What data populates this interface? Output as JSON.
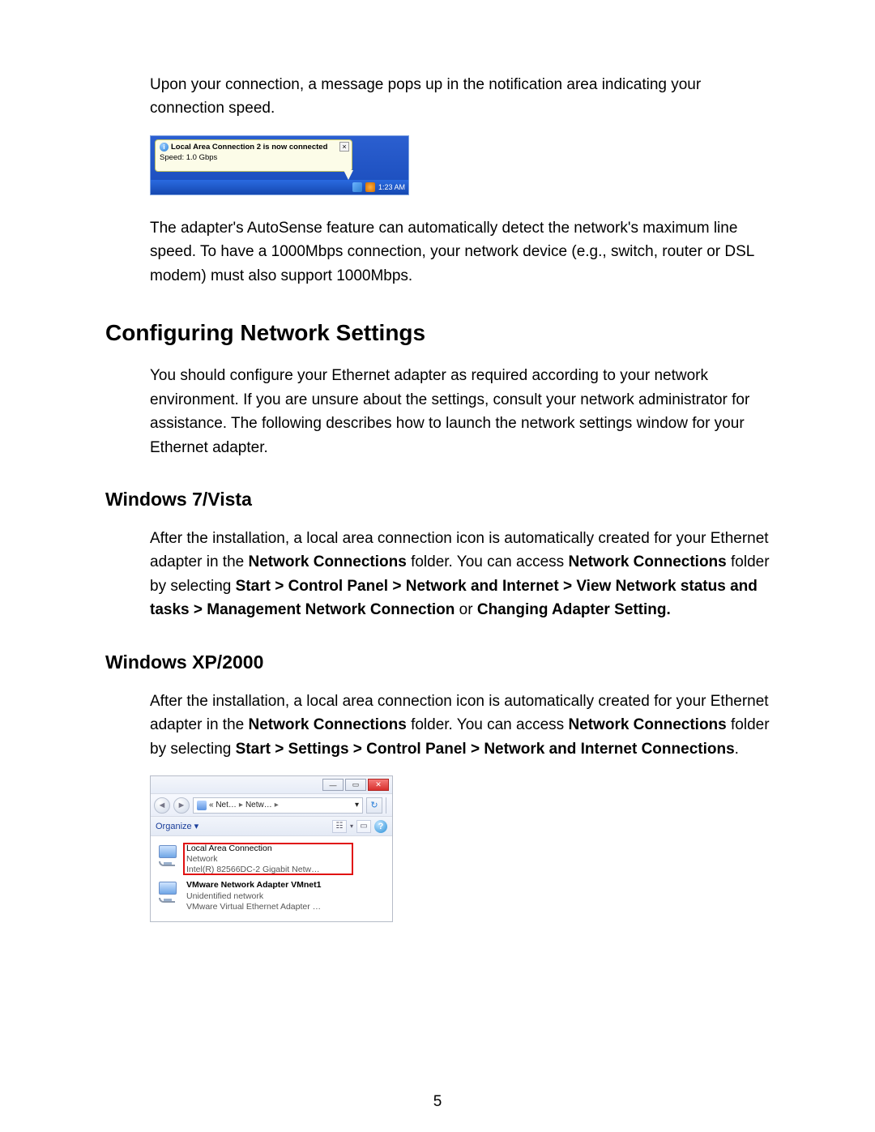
{
  "intro_para": "Upon your connection, a message pops up in the notification area indicating your connection speed.",
  "notification": {
    "title": "Local Area Connection 2 is now connected",
    "speed": "Speed: 1.0 Gbps",
    "clock": "1:23 AM",
    "close_glyph": "×",
    "info_glyph": "i"
  },
  "autosense_para": "The adapter's AutoSense feature can automatically detect the network's maximum line speed. To have a 1000Mbps connection, your network device (e.g., switch, router or DSL modem) must also support 1000Mbps.",
  "section_heading": "Configuring Network Settings",
  "configure_intro": "You should configure your Ethernet adapter as required according to your network environment. If you are unsure about the settings, consult your network administrator for assistance. The following describes how to launch the network settings window for your Ethernet adapter.",
  "sub1": {
    "heading": "Windows 7/Vista",
    "text_plain_prefix": "After the installation, a local area connection icon is automatically created for your Ethernet adapter in the ",
    "nc_bold": "Network Connections",
    "text_mid1": " folder. You can access ",
    "nc_bold2": "Network Connections",
    "text_mid2": " folder by selecting ",
    "path_bold": "Start > Control Panel > Network and Internet > View Network status and tasks > Management Network Connection",
    "or_word": " or ",
    "path_bold2": "Changing Adapter Setting.",
    "period": ""
  },
  "sub2": {
    "heading": "Windows XP/2000",
    "text_plain_prefix": "After the installation, a local area connection icon is automatically created for your Ethernet adapter in the ",
    "nc_bold": "Network Connections",
    "text_mid1": " folder. You can access ",
    "nc_bold2": "Network Connections",
    "text_mid2": " folder by selecting ",
    "path_bold": "Start > Settings > Control Panel > Network and Internet Connections",
    "period": "."
  },
  "nc_window": {
    "minimize": "—",
    "maximize": "▭",
    "close": "✕",
    "back": "◄",
    "fwd": "►",
    "crumb1": "«  Net…",
    "crumb_sep": "▸",
    "crumb2": "Netw…",
    "crumb_sep2": "▸",
    "dropdown": "▾",
    "refresh": "↻",
    "organize": "Organize",
    "org_arrow": "▾",
    "view_glyph": "☷",
    "panel_glyph": "▭",
    "help_glyph": "?",
    "items": [
      {
        "l1": "Local Area Connection",
        "l2": "Network",
        "l3": "Intel(R) 82566DC-2 Gigabit Netw…"
      },
      {
        "l1": "VMware Network Adapter VMnet1",
        "l2": "Unidentified network",
        "l3": "VMware Virtual Ethernet Adapter …"
      }
    ]
  },
  "page_number": "5"
}
